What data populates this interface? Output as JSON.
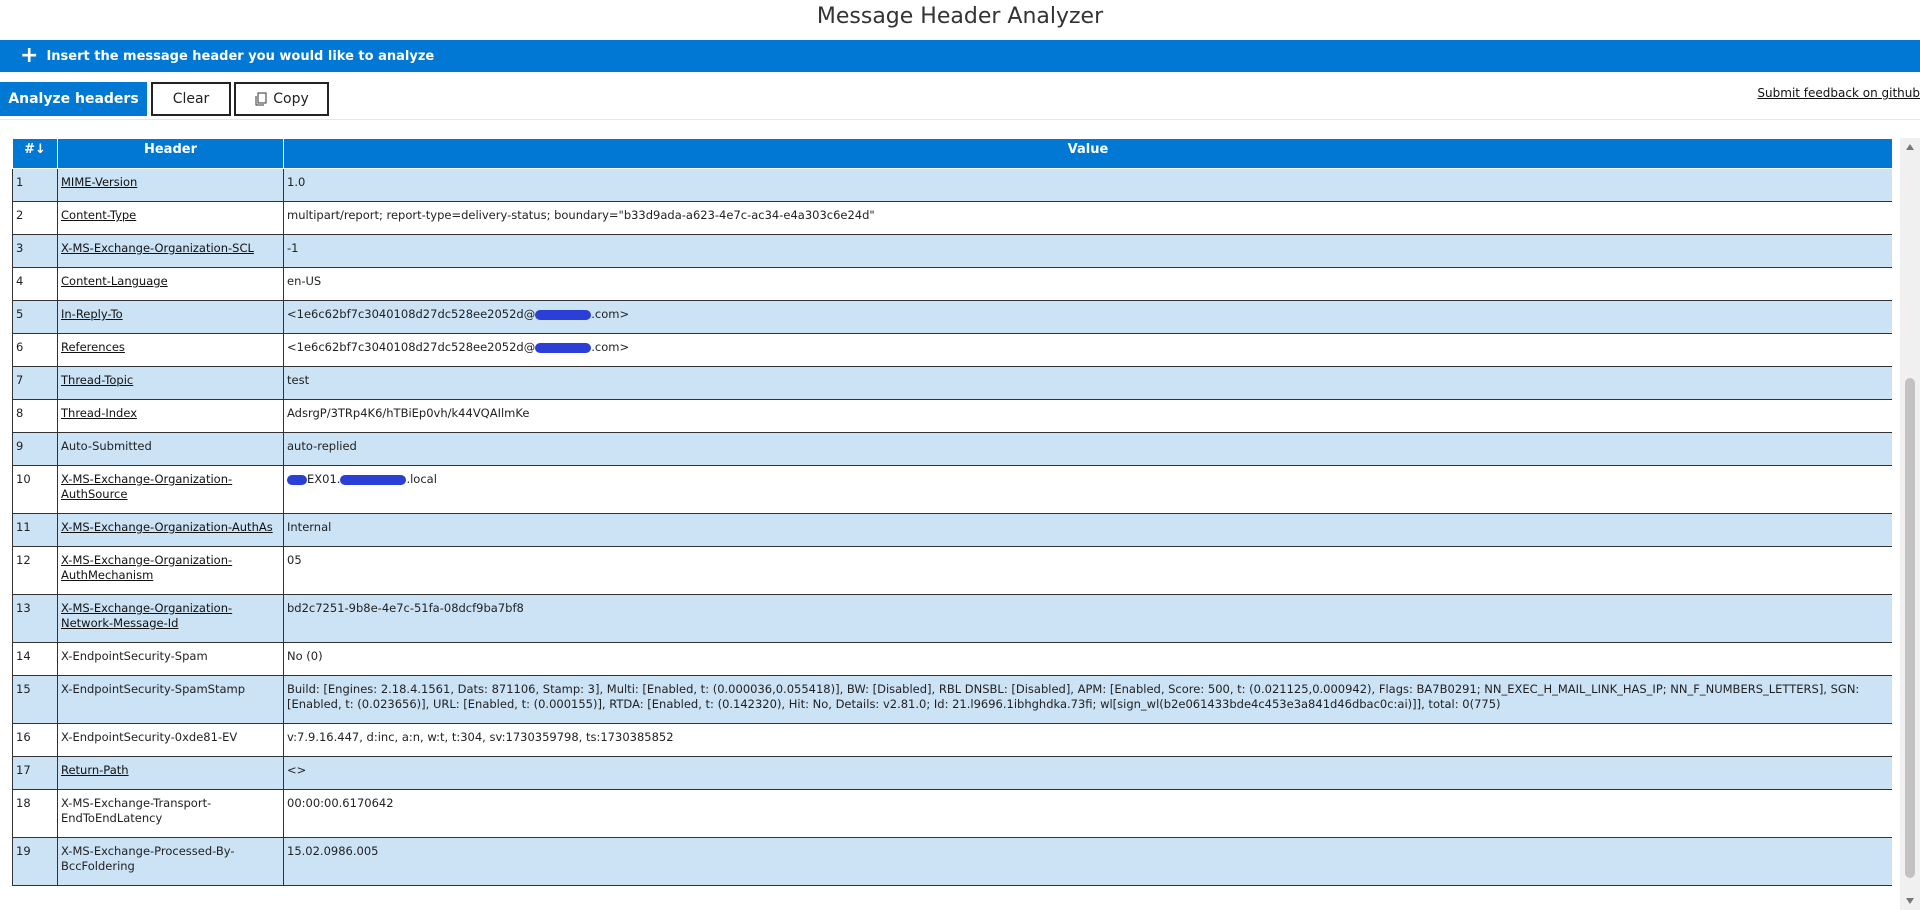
{
  "app": {
    "title": "Message Header Analyzer"
  },
  "insert_bar": {
    "icon": "plus-icon",
    "label": "Insert the message header you would like to analyze"
  },
  "toolbar": {
    "analyze_label": "Analyze headers",
    "clear_label": "Clear",
    "copy_label": "Copy",
    "feedback_label": "Submit feedback on github",
    "accent_color": "#0078d4"
  },
  "table": {
    "columns": [
      "#↓",
      "Header",
      "Value"
    ],
    "rows": [
      {
        "num": "1",
        "header": "MIME-Version",
        "link": true,
        "value": "1.0"
      },
      {
        "num": "2",
        "header": "Content-Type",
        "link": true,
        "value": "multipart/report; report-type=delivery-status; boundary=\"b33d9ada-a623-4e7c-ac34-e4a303c6e24d\""
      },
      {
        "num": "3",
        "header": "X-MS-Exchange-Organization-SCL",
        "link": true,
        "value": "-1"
      },
      {
        "num": "4",
        "header": "Content-Language",
        "link": true,
        "value": "en-US"
      },
      {
        "num": "5",
        "header": "In-Reply-To",
        "link": true,
        "value_pre": "<1e6c62bf7c3040108d27dc528ee2052d@",
        "value_post": ".com>"
      },
      {
        "num": "6",
        "header": "References",
        "link": true,
        "value_pre": "<1e6c62bf7c3040108d27dc528ee2052d@",
        "value_post": ".com>"
      },
      {
        "num": "7",
        "header": "Thread-Topic",
        "link": true,
        "value": "test"
      },
      {
        "num": "8",
        "header": "Thread-Index",
        "link": true,
        "value": "AdsrgP/3TRp4K6/hTBiEp0vh/k44VQAIlmKe"
      },
      {
        "num": "9",
        "header": "Auto-Submitted",
        "link": false,
        "value": "auto-replied"
      },
      {
        "num": "10",
        "header": "X-MS-Exchange-Organization-AuthSource",
        "link": true,
        "value_mid": "EX01.",
        "value_post": ".local"
      },
      {
        "num": "11",
        "header": "X-MS-Exchange-Organization-AuthAs",
        "link": true,
        "value": "Internal"
      },
      {
        "num": "12",
        "header": "X-MS-Exchange-Organization-AuthMechanism",
        "link": true,
        "value": "05"
      },
      {
        "num": "13",
        "header": "X-MS-Exchange-Organization-Network-Message-Id",
        "link": true,
        "value": "bd2c7251-9b8e-4e7c-51fa-08dcf9ba7bf8"
      },
      {
        "num": "14",
        "header": "X-EndpointSecurity-Spam",
        "link": false,
        "value": "No (0)"
      },
      {
        "num": "15",
        "header": "X-EndpointSecurity-SpamStamp",
        "link": false,
        "value": "Build: [Engines: 2.18.4.1561, Dats: 871106, Stamp: 3], Multi: [Enabled, t: (0.000036,0.055418)], BW: [Disabled], RBL DNSBL: [Disabled], APM: [Enabled, Score: 500, t: (0.021125,0.000942), Flags: BA7B0291; NN_EXEC_H_MAIL_LINK_HAS_IP; NN_F_NUMBERS_LETTERS], SGN: [Enabled, t: (0.023656)], URL: [Enabled, t: (0.000155)], RTDA: [Enabled, t: (0.142320), Hit: No, Details: v2.81.0; Id: 21.l9696.1ibhghdka.73fi; wl[sign_wl(b2e061433bde4c453e3a841d46dbac0c:ai)]], total: 0(775)"
      },
      {
        "num": "16",
        "header": "X-EndpointSecurity-0xde81-EV",
        "link": false,
        "value": "v:7.9.16.447, d:inc, a:n, w:t, t:304, sv:1730359798, ts:1730385852"
      },
      {
        "num": "17",
        "header": "Return-Path",
        "link": true,
        "value": "<>"
      },
      {
        "num": "18",
        "header": "X-MS-Exchange-Transport-EndToEndLatency",
        "link": false,
        "value": "00:00:00.6170642"
      },
      {
        "num": "19",
        "header": "X-MS-Exchange-Processed-By-BccFoldering",
        "link": false,
        "value": "15.02.0986.005"
      }
    ]
  }
}
